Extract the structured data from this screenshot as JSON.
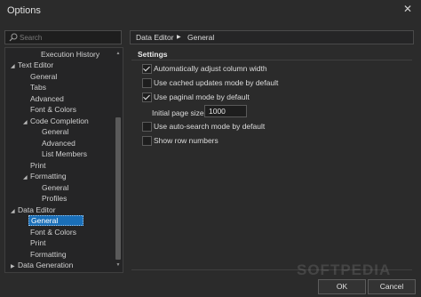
{
  "window": {
    "title": "Options",
    "close_glyph": "✕"
  },
  "search": {
    "placeholder": "Search",
    "value": ""
  },
  "tree": {
    "items": [
      {
        "label": "Execution History",
        "level": 2,
        "arrow": ""
      },
      {
        "label": "Text Editor",
        "level": 0,
        "arrow": "◢"
      },
      {
        "label": "General",
        "level": 1,
        "arrow": ""
      },
      {
        "label": "Tabs",
        "level": 1,
        "arrow": ""
      },
      {
        "label": "Advanced",
        "level": 1,
        "arrow": ""
      },
      {
        "label": "Font & Colors",
        "level": 1,
        "arrow": ""
      },
      {
        "label": "Code Completion",
        "level": 1,
        "arrow": "◢"
      },
      {
        "label": "General",
        "level": 2,
        "arrow": ""
      },
      {
        "label": "Advanced",
        "level": 2,
        "arrow": ""
      },
      {
        "label": "List Members",
        "level": 2,
        "arrow": ""
      },
      {
        "label": "Print",
        "level": 1,
        "arrow": ""
      },
      {
        "label": "Formatting",
        "level": 1,
        "arrow": "◢"
      },
      {
        "label": "General",
        "level": 2,
        "arrow": ""
      },
      {
        "label": "Profiles",
        "level": 2,
        "arrow": ""
      },
      {
        "label": "Data Editor",
        "level": 0,
        "arrow": "◢"
      },
      {
        "label": "General",
        "level": 1,
        "arrow": "",
        "selected": true
      },
      {
        "label": "Font & Colors",
        "level": 1,
        "arrow": ""
      },
      {
        "label": "Print",
        "level": 1,
        "arrow": ""
      },
      {
        "label": "Formatting",
        "level": 1,
        "arrow": ""
      },
      {
        "label": "Data Generation",
        "level": 0,
        "arrow": "▶"
      }
    ],
    "scroll_up_glyph": "▲",
    "scroll_down_glyph": "▼"
  },
  "breadcrumb": {
    "root": "Data Editor",
    "separator": "▶",
    "current": "General"
  },
  "settings": {
    "heading": "Settings",
    "options": [
      {
        "label": "Automatically adjust column width",
        "checked": true
      },
      {
        "label": "Use cached updates mode by default",
        "checked": false
      },
      {
        "label": "Use paginal mode by default",
        "checked": true
      },
      {
        "label": "Use auto-search mode by default",
        "checked": false
      },
      {
        "label": "Show row numbers",
        "checked": false
      }
    ],
    "page_size_label": "Initial page size:",
    "page_size_value": "1000"
  },
  "buttons": {
    "ok": "OK",
    "cancel": "Cancel"
  },
  "watermark": "SOFTPEDIA",
  "colors": {
    "background": "#2b2b2b",
    "selection": "#1a6fb8"
  }
}
